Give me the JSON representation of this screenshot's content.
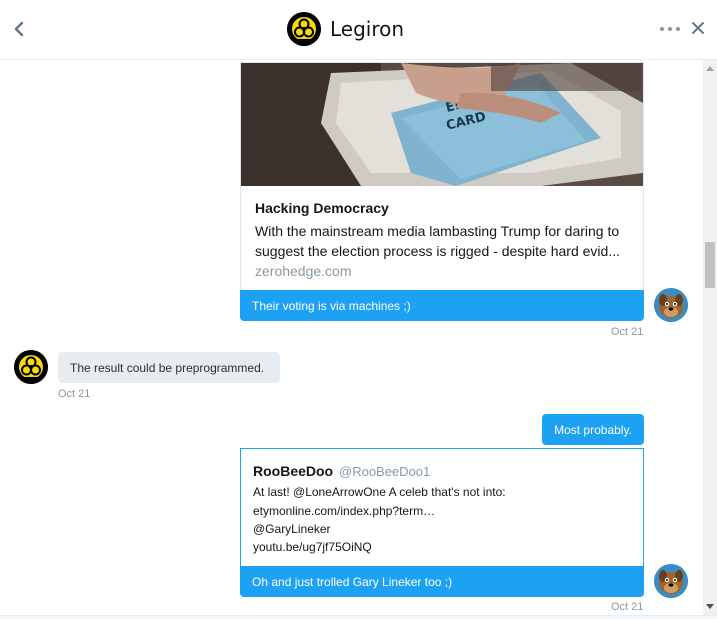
{
  "header": {
    "title": "Legiron",
    "back_icon": "chevron-left-icon",
    "more_icon": "more-dots-icon",
    "close_icon": "close-icon"
  },
  "messages": {
    "link_card": {
      "title": "Hacking Democracy",
      "description": "With the mainstream media lambasting Trump for daring to suggest the election process is rigged - despite hard evid...",
      "domain": "zerohedge.com"
    },
    "msg1": {
      "text": "Their voting is via machines ;)",
      "timestamp": "Oct 21"
    },
    "msg2": {
      "text": "The result could be preprogrammed.",
      "timestamp": "Oct 21"
    },
    "msg3": {
      "text": "Most probably."
    },
    "quote": {
      "name": "RooBeeDoo",
      "handle": "@RooBeeDoo1",
      "line1": "At last! @LoneArrowOne A celeb that's not into:",
      "line2": "etymonline.com/index.php?term…",
      "line3": "@GaryLineker",
      "line4": "youtu.be/ug7jf75OiNQ"
    },
    "msg4": {
      "text": "Oh and just trolled Gary Lineker too ;)",
      "timestamp": "Oct 21"
    }
  },
  "colors": {
    "accent": "#1da1f2",
    "grey_bubble": "#e6ecf0",
    "muted_text": "#8899a6"
  }
}
